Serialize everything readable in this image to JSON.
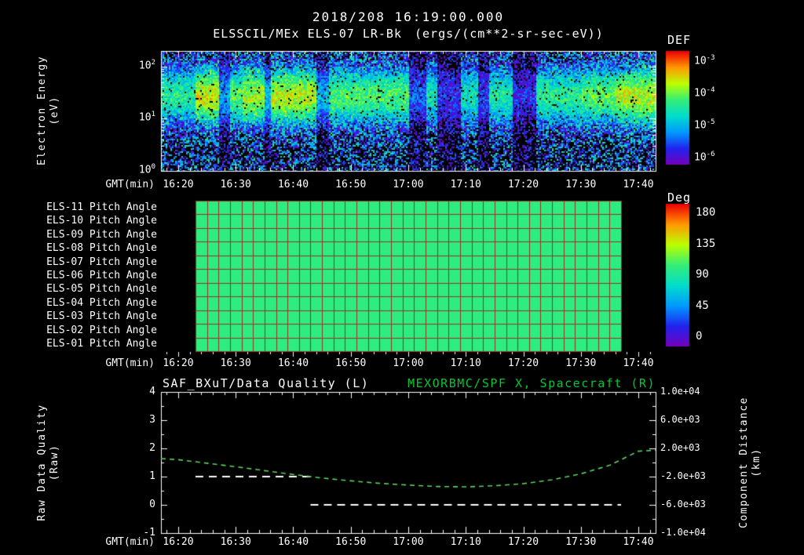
{
  "page": {
    "bg": "#000000",
    "title_datetime": "2018/208 16:19:00.000",
    "title_main": "ELSSCIL/MEx ELS-07 LR-Bk",
    "title_units": "(ergs/(cm**2-sr-sec-eV))"
  },
  "colors": {
    "text": "#ffffff",
    "green_text": "#00c832",
    "curve_green": "#5fd35f",
    "quality_white": "#ffffff",
    "pitch_grid": "#993322",
    "frame": "#ffffff",
    "colormap": [
      "#7700bb",
      "#2222ee",
      "#0099ff",
      "#00ddcc",
      "#33ee77",
      "#bbff00",
      "#ff9900",
      "#ee0000"
    ]
  },
  "chart_data": [
    {
      "type": "heatmap",
      "name": "electron-energy-spectrogram",
      "title": "ELSSCIL/MEx ELS-07 LR-Bk",
      "units": "(ergs/(cm**2-sr-sec-eV))",
      "xlabel": "GMT(min)",
      "ylabel": "Electron Energy (eV)",
      "ylabel_lines": [
        "Electron Energy",
        "(eV)"
      ],
      "x_range": [
        "16:17",
        "17:43"
      ],
      "x_ticks": [
        "16:20",
        "16:30",
        "16:40",
        "16:50",
        "17:00",
        "17:10",
        "17:20",
        "17:30",
        "17:40"
      ],
      "y_log10_range": [
        0,
        2.3
      ],
      "y_tick_exponents": [
        2,
        1,
        0
      ],
      "colorbar": {
        "label": "DEF",
        "tick_exponents": [
          -3,
          -4,
          -5,
          -6
        ],
        "log10_range": [
          -3,
          -6.5
        ]
      },
      "band_energy_ev": [
        8,
        120
      ],
      "band_log_center": 1.45,
      "band_log_width": 0.6,
      "segments": [
        {
          "t0": "16:19",
          "t1": "16:23",
          "band_log_flux": -4.7
        },
        {
          "t0": "16:23",
          "t1": "16:27",
          "band_log_flux": -3.9
        },
        {
          "t0": "16:27",
          "t1": "16:29",
          "band_log_flux": -5.4,
          "dropout": true
        },
        {
          "t0": "16:29",
          "t1": "16:31",
          "band_log_flux": -4.5
        },
        {
          "t0": "16:31",
          "t1": "16:35",
          "band_log_flux": -4.1
        },
        {
          "t0": "16:35",
          "t1": "16:36",
          "band_log_flux": -5.2,
          "dropout": true
        },
        {
          "t0": "16:36",
          "t1": "16:44",
          "band_log_flux": -4.0
        },
        {
          "t0": "16:44",
          "t1": "16:46",
          "band_log_flux": -5.3,
          "dropout": true
        },
        {
          "t0": "16:46",
          "t1": "17:00",
          "band_log_flux": -4.5
        },
        {
          "t0": "17:00",
          "t1": "17:03",
          "band_log_flux": -5.8,
          "dropout": true
        },
        {
          "t0": "17:03",
          "t1": "17:05",
          "band_log_flux": -4.9
        },
        {
          "t0": "17:05",
          "t1": "17:09",
          "band_log_flux": -6.0,
          "dropout": true
        },
        {
          "t0": "17:09",
          "t1": "17:12",
          "band_log_flux": -4.9
        },
        {
          "t0": "17:12",
          "t1": "17:14",
          "band_log_flux": -5.9,
          "dropout": true
        },
        {
          "t0": "17:14",
          "t1": "17:18",
          "band_log_flux": -4.8
        },
        {
          "t0": "17:18",
          "t1": "17:22",
          "band_log_flux": -6.0,
          "dropout": true
        },
        {
          "t0": "17:22",
          "t1": "17:30",
          "band_log_flux": -4.7
        },
        {
          "t0": "17:30",
          "t1": "17:36",
          "band_log_flux": -4.4
        },
        {
          "t0": "17:36",
          "t1": "17:43",
          "band_log_flux": -4.0
        }
      ]
    },
    {
      "type": "heatmap",
      "name": "pitch-angle-panel",
      "xlabel": "GMT(min)",
      "x_range": [
        "16:17",
        "17:43"
      ],
      "x_ticks": [
        "16:20",
        "16:30",
        "16:40",
        "16:50",
        "17:00",
        "17:10",
        "17:20",
        "17:30",
        "17:40"
      ],
      "rows": [
        "ELS-11 Pitch Angle",
        "ELS-10 Pitch Angle",
        "ELS-09 Pitch Angle",
        "ELS-08 Pitch Angle",
        "ELS-07 Pitch Angle",
        "ELS-06 Pitch Angle",
        "ELS-05 Pitch Angle",
        "ELS-04 Pitch Angle",
        "ELS-03 Pitch Angle",
        "ELS-02 Pitch Angle",
        "ELS-01 Pitch Angle"
      ],
      "data_start": "16:23",
      "data_end": "17:37",
      "value_deg": 100,
      "cell_minutes": 2,
      "colorbar": {
        "label": "Deg",
        "ticks": [
          180,
          135,
          90,
          45,
          0
        ],
        "range": [
          0,
          180
        ]
      }
    },
    {
      "type": "line",
      "name": "quality-and-spacecraft-distance",
      "title_left": "SAF_BXuT/Data Quality (L)",
      "title_right": "MEXORBMC/SPF X, Spacecraft (R)",
      "xlabel": "GMT(min)",
      "x_range": [
        "16:17",
        "17:43"
      ],
      "x_ticks": [
        "16:20",
        "16:30",
        "16:40",
        "16:50",
        "17:00",
        "17:10",
        "17:20",
        "17:30",
        "17:40"
      ],
      "left_axis": {
        "label": "Raw Data Quality (Raw)",
        "label_lines": [
          "Raw Data Quality",
          "(Raw)"
        ],
        "ticks": [
          4,
          3,
          2,
          1,
          0,
          -1
        ],
        "range": [
          -1,
          4
        ]
      },
      "right_axis": {
        "label": "Component Distance (km)",
        "label_lines": [
          "Component Distance",
          "(km)"
        ],
        "ticks": [
          "1.0e+04",
          "6.0e+03",
          "2.0e+03",
          "-2.0e+03",
          "-6.0e+03",
          "-1.0e+04"
        ],
        "range": [
          -10000,
          10000
        ]
      },
      "series": [
        {
          "name": "SAF_BXuT/Data Quality",
          "axis": "left",
          "style": "dashed",
          "color": "#ffffff",
          "segments": [
            {
              "points": [
                [
                  "16:23",
                  1
                ],
                [
                  "16:43",
                  1
                ]
              ]
            },
            {
              "points": [
                [
                  "16:43",
                  0
                ],
                [
                  "17:37",
                  0
                ]
              ]
            }
          ]
        },
        {
          "name": "MEXORBMC/SPF X Spacecraft",
          "axis": "right",
          "style": "dashed",
          "color": "#5fd35f",
          "points": [
            [
              "16:17",
              550
            ],
            [
              "16:20",
              400
            ],
            [
              "16:25",
              -100
            ],
            [
              "16:30",
              -600
            ],
            [
              "16:35",
              -1150
            ],
            [
              "16:40",
              -1700
            ],
            [
              "16:45",
              -2200
            ],
            [
              "16:50",
              -2600
            ],
            [
              "16:55",
              -2950
            ],
            [
              "17:00",
              -3200
            ],
            [
              "17:05",
              -3400
            ],
            [
              "17:10",
              -3450
            ],
            [
              "17:15",
              -3300
            ],
            [
              "17:20",
              -3000
            ],
            [
              "17:25",
              -2450
            ],
            [
              "17:30",
              -1600
            ],
            [
              "17:35",
              -400
            ],
            [
              "17:40",
              1600
            ],
            [
              "17:43",
              1750
            ]
          ]
        }
      ]
    }
  ]
}
